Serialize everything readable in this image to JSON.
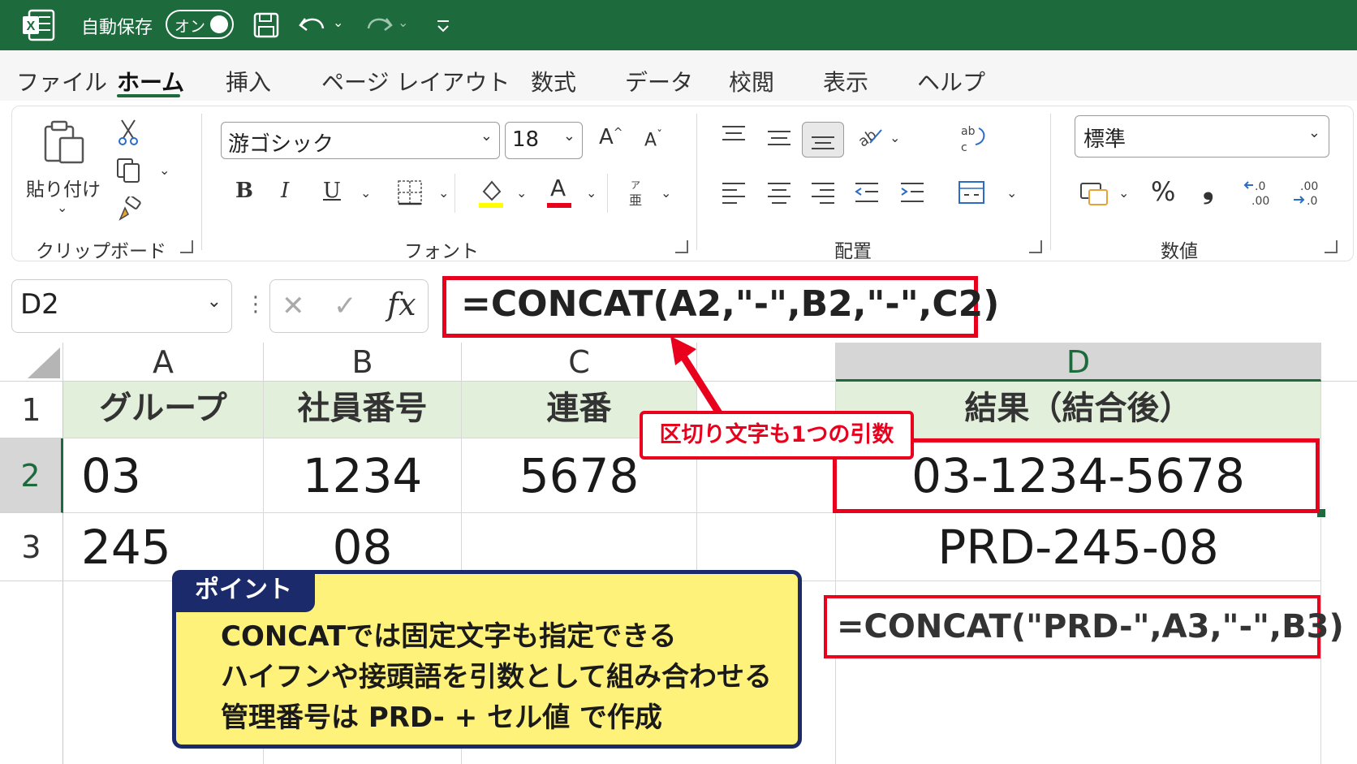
{
  "titlebar": {
    "autosave_label": "自動保存",
    "autosave_state": "オン"
  },
  "tabs": [
    "ファイル",
    "ホーム",
    "挿入",
    "ページ レイアウト",
    "数式",
    "データ",
    "校閲",
    "表示",
    "ヘルプ"
  ],
  "ribbon": {
    "clipboard": {
      "paste_label": "貼り付け",
      "group_label": "クリップボード"
    },
    "font": {
      "font_name": "游ゴシック",
      "font_size": "18",
      "group_label": "フォント",
      "bold": "B",
      "italic": "I",
      "underline": "U",
      "font_color_letter": "A"
    },
    "alignment": {
      "group_label": "配置"
    },
    "number": {
      "format": "標準",
      "group_label": "数値",
      "percent": "%",
      "comma": "❟"
    }
  },
  "formula_bar": {
    "name_box": "D2",
    "fx": "fx",
    "formula": "=CONCAT(A2,\"-\",B2,\"-\",C2)"
  },
  "sheet": {
    "columns": [
      "A",
      "B",
      "C",
      "D"
    ],
    "rows": [
      "1",
      "2",
      "3"
    ],
    "header_row": [
      "グループ",
      "社員番号",
      "連番",
      "結果（結合後）"
    ],
    "row2": [
      "03",
      "1234",
      "5678",
      "03-1234-5678"
    ],
    "row3": [
      "245",
      "08",
      "",
      "PRD-245-08"
    ]
  },
  "annotations": {
    "callout": "区切り文字も1つの引数",
    "formula2": "=CONCAT(\"PRD-\",A3,\"-\",B3)",
    "point_title": "ポイント",
    "point_lines": [
      "CONCATでは固定文字も指定できる",
      "ハイフンや接頭語を引数として組み合わせる",
      "管理番号は PRD- + セル値 で作成"
    ]
  },
  "colors": {
    "title_bar": "#1d6b3c",
    "header_fill": "#e2efda",
    "highlight_red": "#e8001c",
    "point_fill": "#fff27a",
    "point_border": "#1a2a6b"
  }
}
